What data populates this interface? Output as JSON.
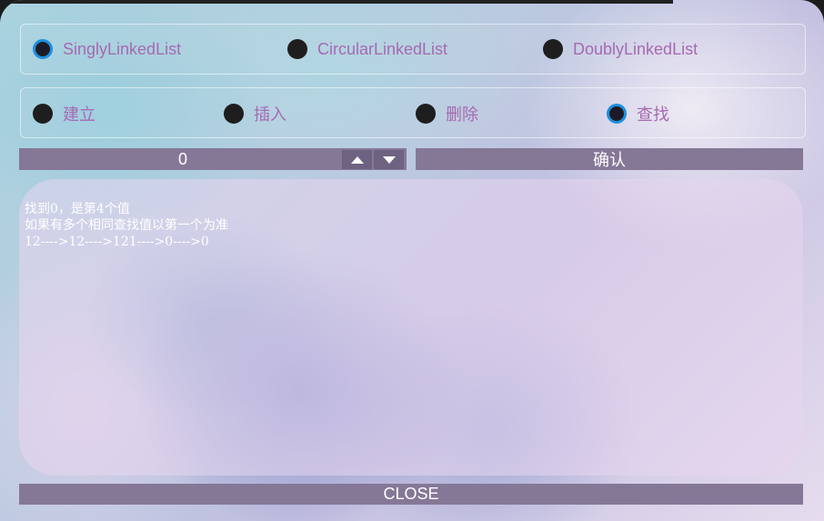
{
  "list_types": {
    "options": [
      "SinglyLinkedList",
      "CircularLinkedList",
      "DoublyLinkedList"
    ],
    "selected": "SinglyLinkedList"
  },
  "operations": {
    "options": [
      "建立",
      "插入",
      "删除",
      "查找"
    ],
    "selected": "查找"
  },
  "input": {
    "value": "0"
  },
  "confirm_label": "确认",
  "output": {
    "lines": [
      "找到0，是第4个值",
      "如果有多个相同查找值以第一个为准",
      "12---->12---->121---->0---->0"
    ]
  },
  "close_label": "CLOSE",
  "colors": {
    "accent": "#1e8fe0",
    "label": "#a66ab2",
    "bar": "#857897"
  }
}
